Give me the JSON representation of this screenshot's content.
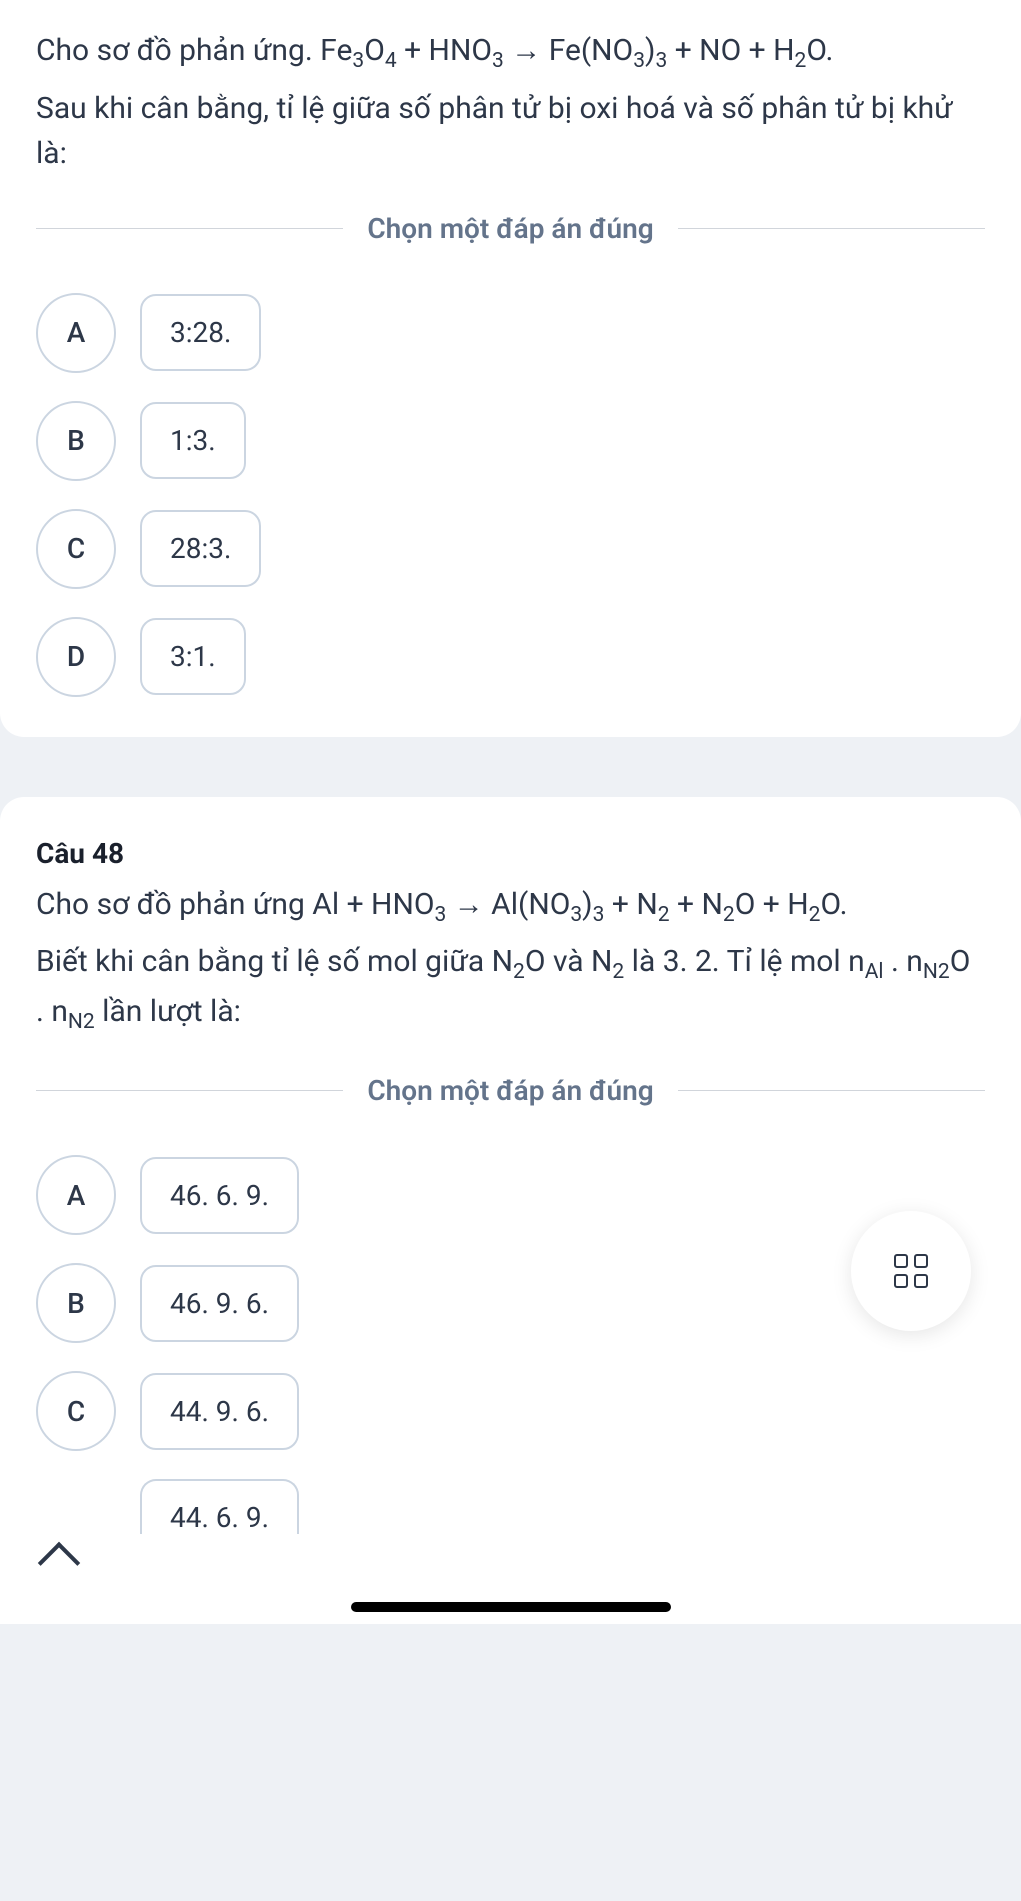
{
  "q47": {
    "text_line1_prefix": "Cho sơ đồ phản ứng. Fe",
    "text_line1_mid": "O",
    "text_line1_plus": " + HNO",
    "text_line1_arrow": " → Fe(NO",
    "text_line1_end": ")",
    "text_line1_tail": " + NO + H",
    "text_line1_final": "O.",
    "text_line2": "Sau khi cân bằng, tỉ lệ giữa số phân tử bị oxi hoá và số phân tử bị khử là:",
    "instruction": "Chọn một đáp án đúng",
    "options": [
      {
        "letter": "A",
        "value": "3:28."
      },
      {
        "letter": "B",
        "value": "1:3."
      },
      {
        "letter": "C",
        "value": "28:3."
      },
      {
        "letter": "D",
        "value": "3:1."
      }
    ]
  },
  "q48": {
    "title": "Câu 48",
    "line1a": "Cho sơ đồ phản ứng Al + HNO",
    "line1b": " → Al(NO",
    "line1c": ")",
    "line1d": " + N",
    "line1e": " + N",
    "line1f": "O + H",
    "line1g": "O.",
    "line2a": "Biết khi cân bằng tỉ lệ số mol giữa N",
    "line2b": "O và N",
    "line2c": " là 3. 2. Tỉ lệ mol n",
    "line2d": " . n",
    "line2e": "O . n",
    "line2f": " lần lượt là:",
    "instruction": "Chọn một đáp án đúng",
    "options": [
      {
        "letter": "A",
        "value": "46. 6. 9."
      },
      {
        "letter": "B",
        "value": "46. 9. 6."
      },
      {
        "letter": "C",
        "value": "44. 9. 6."
      }
    ],
    "cutoff": "44. 6. 9."
  },
  "subs": {
    "3": "3",
    "4": "4",
    "2": "2",
    "Al": "Al",
    "N2": "N2"
  }
}
